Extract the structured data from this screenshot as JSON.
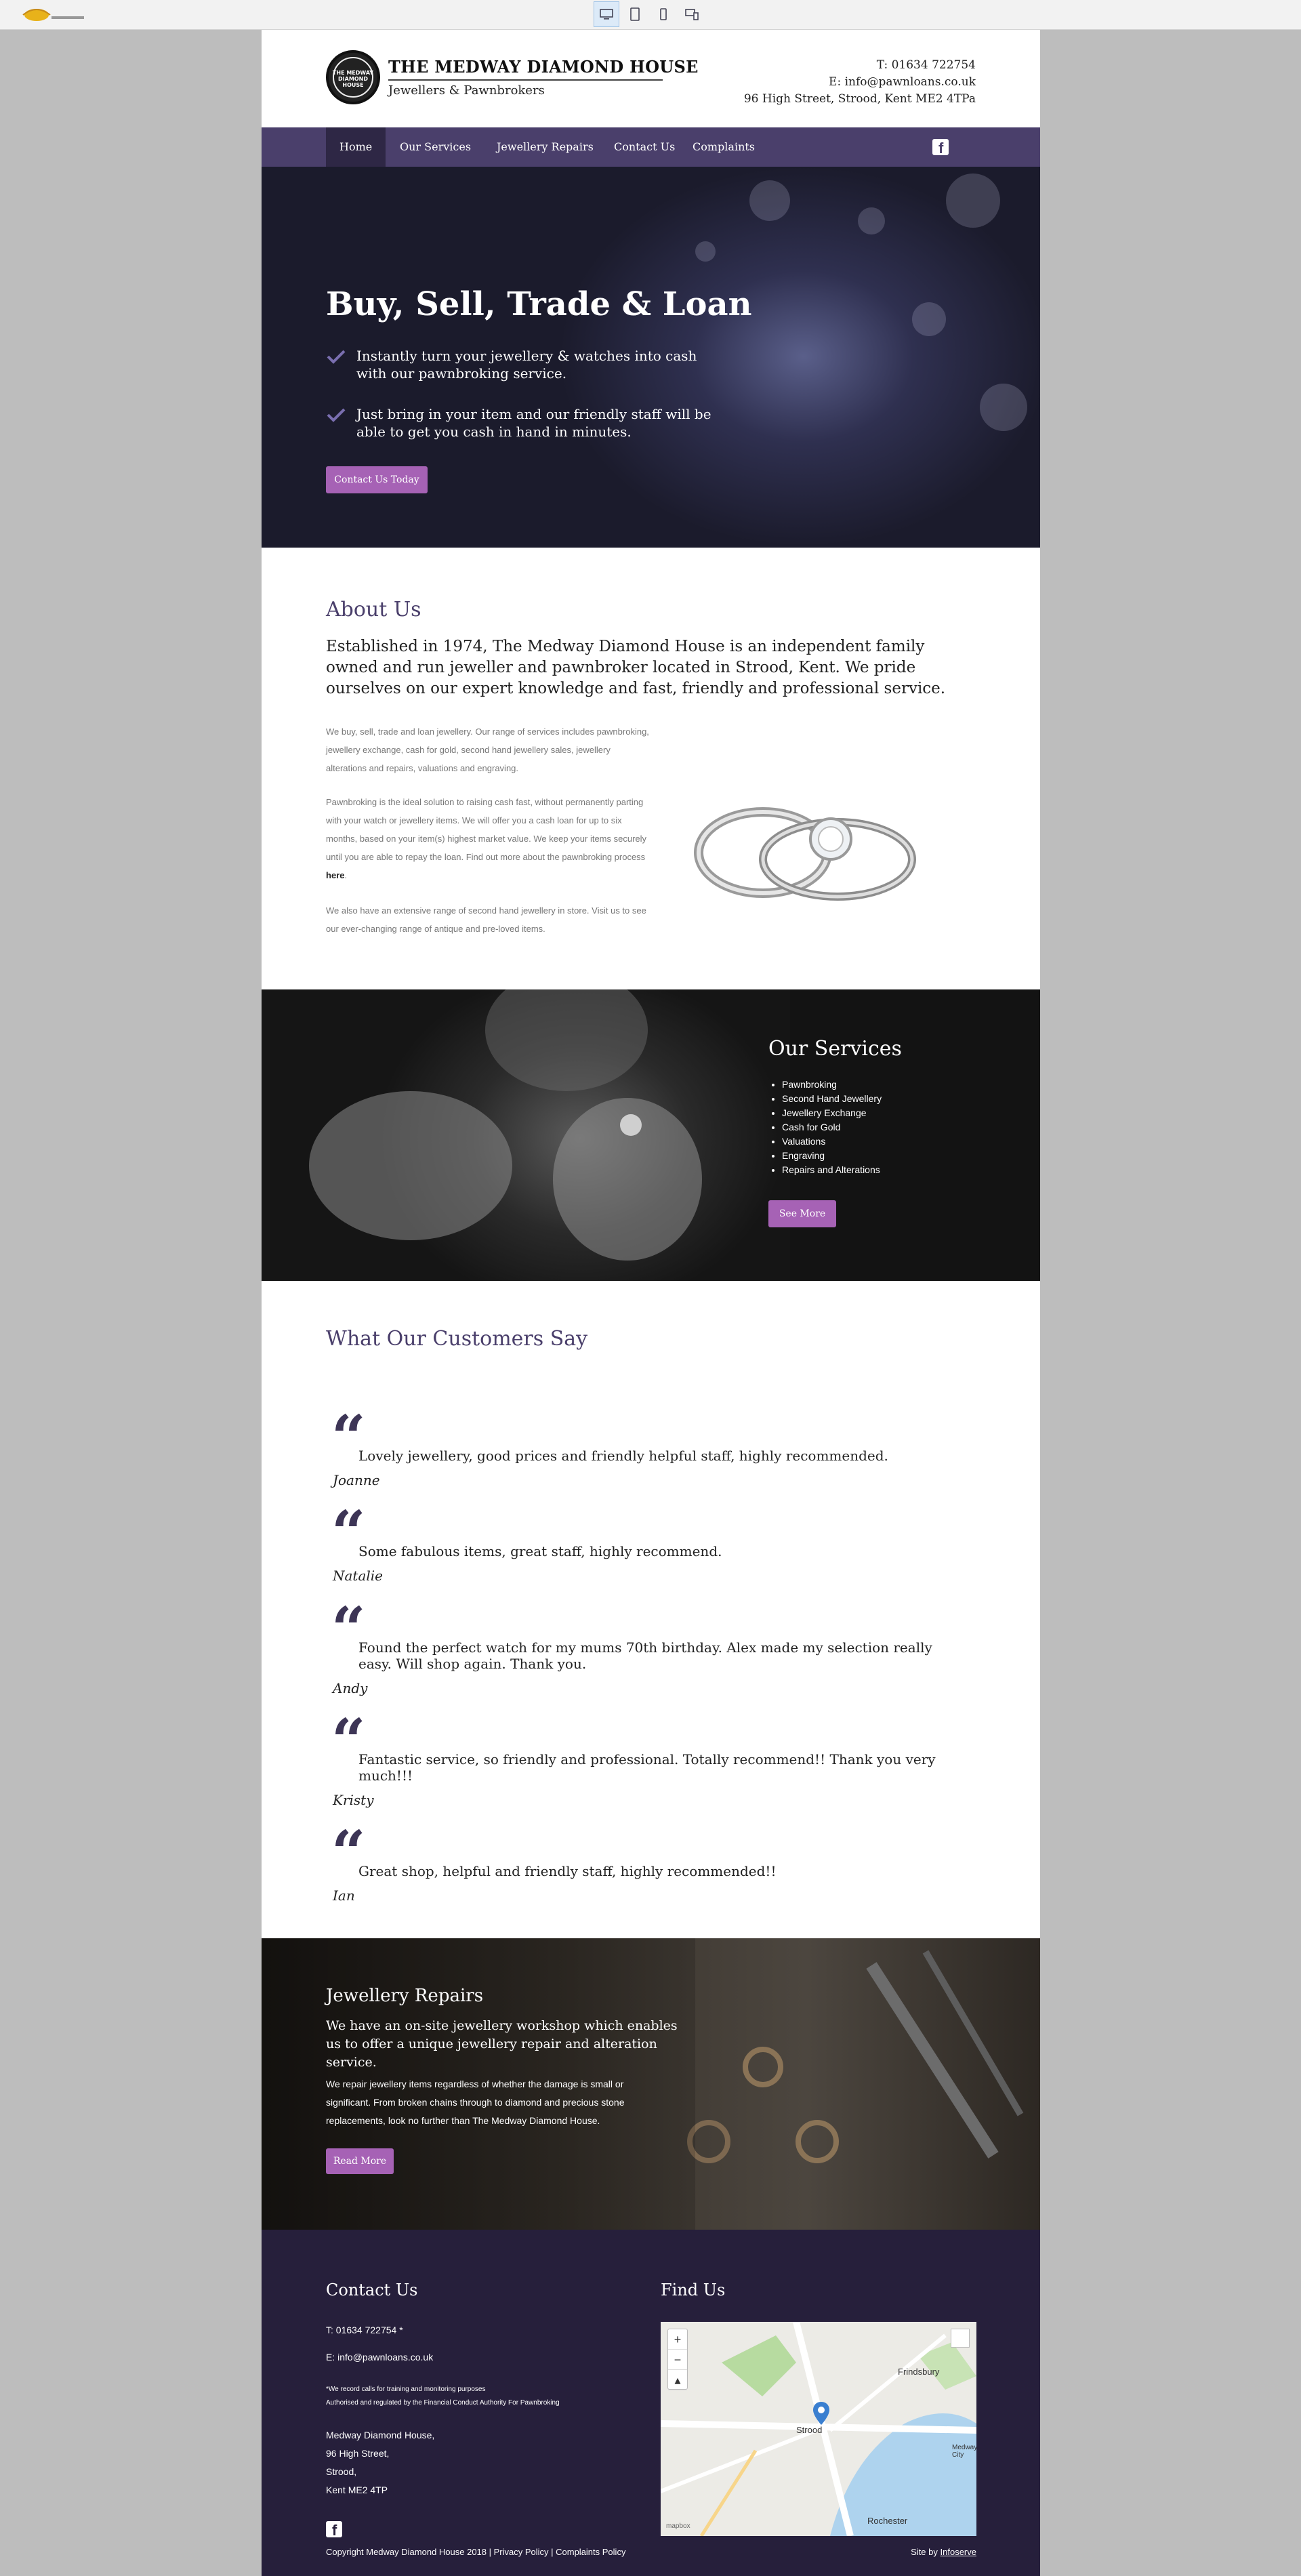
{
  "colors": {
    "brand_purple": "#4a3f6b",
    "button_pink": "#a662b5",
    "footer_bg": "#261f3b"
  },
  "header": {
    "logo_text": "THE MEDWAY DIAMOND HOUSE",
    "title": "THE MEDWAY DIAMOND HOUSE",
    "subtitle": "Jewellers & Pawnbrokers",
    "phone": "T: 01634 722754",
    "email": "E: info@pawnloans.co.uk",
    "address": "96 High Street, Strood, Kent ME2 4TPa"
  },
  "nav": {
    "items": [
      {
        "label": "Home"
      },
      {
        "label": "Our Services"
      },
      {
        "label": "Jewellery Repairs"
      },
      {
        "label": "Contact Us"
      },
      {
        "label": "Complaints"
      }
    ],
    "social_icon": "facebook-icon"
  },
  "hero": {
    "title": "Buy, Sell, Trade & Loan",
    "bullets": [
      "Instantly turn your jewellery & watches into cash with our pawnbroking service.",
      "Just bring in your item and our friendly staff will be able to get you cash in hand in minutes."
    ],
    "button": "Contact Us Today"
  },
  "about": {
    "heading": "About Us",
    "lead": "Established in 1974, The Medway Diamond House is an independent family owned and run jeweller and pawnbroker located in Strood, Kent. We pride ourselves on our expert knowledge and fast, friendly and professional service.",
    "p1": "We buy, sell, trade and loan jewellery. Our range of services includes pawnbroking, jewellery exchange, cash for gold, second hand jewellery sales, jewellery alterations and repairs, valuations and engraving.",
    "p2": "Pawnbroking is the ideal solution to raising cash fast, without permanently parting with your watch or jewellery items. We will offer you a cash loan for up to six months, based on your item(s) highest market value. We keep your items securely until you are able to repay the loan. Find out more about the pawnbroking process",
    "p2_link": "here",
    "p3": "We also have an extensive range of second hand jewellery in store. Visit us to see our ever-changing range of antique and pre-loved items."
  },
  "services": {
    "heading": "Our Services",
    "items": [
      "Pawnbroking",
      "Second Hand Jewellery",
      "Jewellery Exchange",
      "Cash for Gold",
      "Valuations",
      "Engraving",
      "Repairs and Alterations"
    ],
    "button": "See More"
  },
  "testimonials": {
    "heading": "What Our Customers Say",
    "items": [
      {
        "text": "Lovely jewellery, good prices and friendly helpful staff, highly recommended.",
        "author": "Joanne"
      },
      {
        "text": "Some fabulous items, great staff, highly recommend.",
        "author": "Natalie"
      },
      {
        "text": "Found the perfect watch for my mums 70th birthday. Alex made my selection really easy. Will shop again. Thank you.",
        "author": "Andy"
      },
      {
        "text": "Fantastic service, so friendly and professional. Totally recommend!! Thank you very much!!!",
        "author": "Kristy"
      },
      {
        "text": "Great shop, helpful and friendly staff, highly recommended!!",
        "author": "Ian"
      }
    ]
  },
  "repairs": {
    "heading": "Jewellery Repairs",
    "lead": "We have an on-site jewellery workshop which enables us to offer a unique jewellery repair and alteration service.",
    "para": "We repair jewellery items regardless of whether the damage is small or significant. From broken chains through to diamond and precious stone replacements, look no further than The Medway Diamond House.",
    "button": "Read More"
  },
  "footer": {
    "contact_heading": "Contact Us",
    "find_heading": "Find Us",
    "phone": "T: 01634 722754 *",
    "email": "E: info@pawnloans.co.uk",
    "note1": "*We record calls for training and monitoring purposes",
    "note2": "Authorised and regulated by the Financial Conduct Authority For Pawnbroking",
    "address": [
      "Medway Diamond House,",
      "96 High Street,",
      "Strood,",
      "Kent ME2 4TP"
    ],
    "copyright": "Copyright Medway Diamond House 2018 | Privacy Policy | Complaints Policy",
    "credit_prefix": "Site by",
    "credit_link": "Infoserve"
  },
  "map": {
    "labels": [
      "Strood",
      "Rochester",
      "Frindsbury",
      "Medway City"
    ],
    "zoom_in": "+",
    "zoom_out": "−",
    "attribution": "mapbox"
  }
}
